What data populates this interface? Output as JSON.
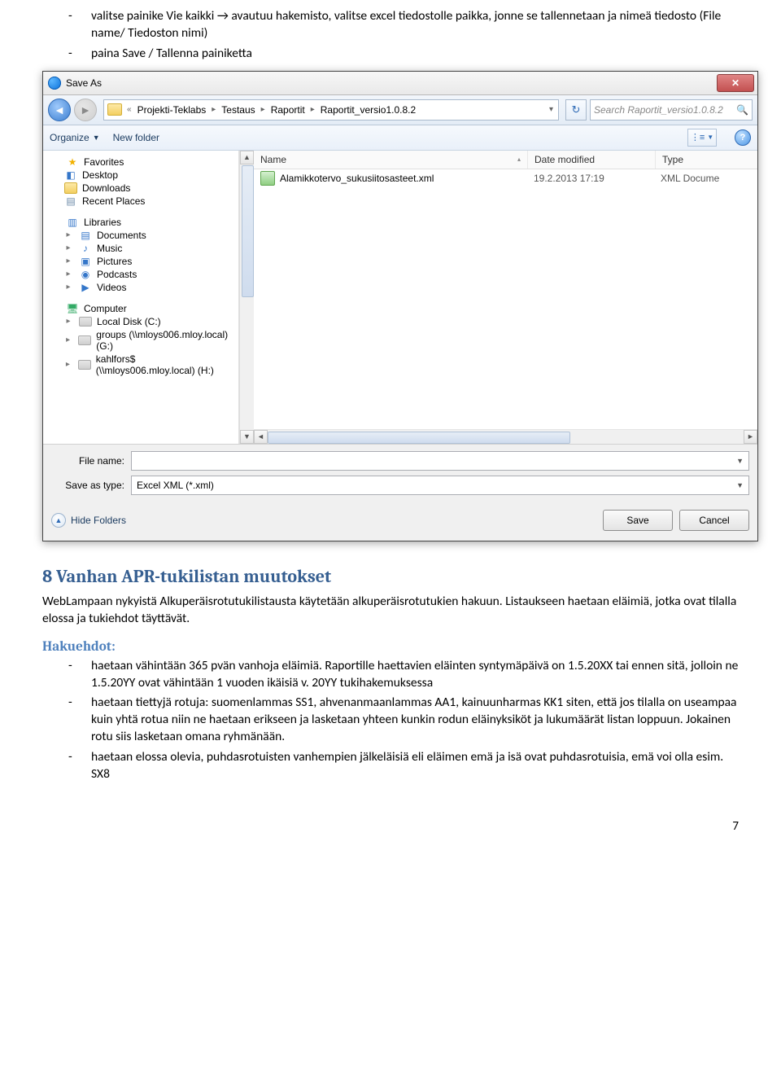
{
  "intro_list": [
    "valitse painike Vie kaikki → avautuu hakemisto, valitse excel tiedostolle paikka, jonne se tallennetaan ja nimeä tiedosto (File name/ Tiedoston nimi)",
    "paina Save / Tallenna painiketta"
  ],
  "dialog": {
    "title": "Save As",
    "close": "✕",
    "breadcrumb_prefix": "«",
    "breadcrumb": [
      "Projekti-Teklabs",
      "Testaus",
      "Raportit",
      "Raportit_versio1.0.8.2"
    ],
    "search_placeholder": "Search Raportit_versio1.0.8.2",
    "organize": "Organize",
    "new_folder": "New folder",
    "view_icon": "⋮≡",
    "help": "?",
    "columns": {
      "name": "Name",
      "date": "Date modified",
      "type": "Type"
    },
    "file": {
      "name": "Alamikkotervo_sukusiitosasteet.xml",
      "date": "19.2.2013 17:19",
      "type": "XML Docume"
    },
    "nav": {
      "favorites": "Favorites",
      "desktop": "Desktop",
      "downloads": "Downloads",
      "recent": "Recent Places",
      "libraries": "Libraries",
      "documents": "Documents",
      "music": "Music",
      "pictures": "Pictures",
      "podcasts": "Podcasts",
      "videos": "Videos",
      "computer": "Computer",
      "local_disk": "Local Disk (C:)",
      "groups": "groups (\\\\mloys006.mloy.local) (G:)",
      "kahlfors": "kahlfors$ (\\\\mloys006.mloy.local) (H:)"
    },
    "filename_label": "File name:",
    "filename_value": "",
    "saveas_label": "Save as type:",
    "saveas_value": "Excel XML (*.xml)",
    "hide_folders": "Hide Folders",
    "save_btn": "Save",
    "cancel_btn": "Cancel"
  },
  "section": {
    "heading": "8 Vanhan APR-tukilistan muutokset",
    "para": "WebLampaan nykyistä Alkuperäisrotutukilistausta käytetään alkuperäisrotutukien hakuun. Listaukseen haetaan eläimiä, jotka ovat tilalla elossa ja tukiehdot täyttävät.",
    "sub_heading": "Hakuehdot:",
    "items": [
      "haetaan vähintään 365 pvän vanhoja eläimiä. Raportille haettavien eläinten syntymäpäivä on 1.5.20XX tai ennen sitä, jolloin ne 1.5.20YY ovat vähintään 1 vuoden ikäisiä v. 20YY tukihakemuksessa",
      "haetaan tiettyjä rotuja: suomenlammas SS1, ahvenanmaanlammas AA1, kainuunharmas KK1 siten, että jos tilalla on useampaa kuin yhtä rotua niin ne haetaan erikseen ja lasketaan yhteen kunkin rodun eläinyksiköt ja lukumäärät listan loppuun. Jokainen rotu siis lasketaan omana ryhmänään.",
      "haetaan elossa olevia, puhdasrotuisten vanhempien jälkeläisiä eli eläimen emä ja isä ovat puhdasrotuisia, emä voi olla esim. SX8"
    ]
  },
  "page_number": "7"
}
